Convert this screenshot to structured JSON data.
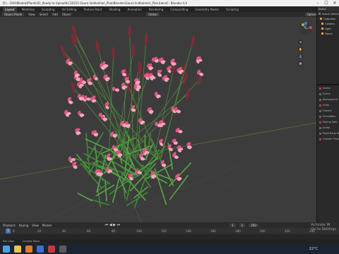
{
  "window": {
    "title": "D:\\...CHU\\Models\\Plants\\01_Ready to Upload\\LC20315 Gaura lindheimeri_Pink\\Blender\\Gaura lindheimeri_Pink.blend] - Blender 4.4",
    "min": "–",
    "max": "☐",
    "close": "✕"
  },
  "menu": {
    "tabs": [
      "Layout",
      "Modeling",
      "Sculpting",
      "UV Editing",
      "Texture Paint",
      "Shading",
      "Animation",
      "Rendering",
      "Compositing",
      "Geometry Nodes",
      "Scripting"
    ],
    "active": "Layout",
    "scene_label": "Scene"
  },
  "viewport_header": {
    "mode": "Object Mode",
    "menus": [
      "View",
      "Select",
      "Add",
      "Object"
    ],
    "orientation": "Global",
    "options": "Options"
  },
  "nav_gizmo": {
    "axes": [
      "X",
      "Y",
      "Z"
    ]
  },
  "outliner": {
    "rows": [
      "Scene Collection",
      "Collection",
      "Camera",
      "Light",
      "Gaura"
    ]
  },
  "properties": {
    "tabs_icons": [
      "tool-icon",
      "render-icon",
      "output-icon",
      "view-layer-icon",
      "scene-icon",
      "world-icon"
    ],
    "rows": [
      "Scene",
      "Scene",
      "Background",
      "Units",
      "Gravity",
      "Simulation",
      "Keying Sets",
      "Audio",
      "Rigid Body World",
      "Custom Properties"
    ]
  },
  "timeline": {
    "menus": [
      "Playback",
      "Keying",
      "View",
      "Marker"
    ],
    "current_frame": "1",
    "start": "1",
    "end": "250",
    "ticks": [
      "0",
      "20",
      "40",
      "60",
      "80",
      "100",
      "120",
      "140",
      "160",
      "180",
      "200",
      "220",
      "240"
    ]
  },
  "status": {
    "left": "Pan View",
    "middle": "Context Menu"
  },
  "watermark": {
    "line1": "Activate W",
    "line2": "Go to Settings"
  },
  "taskbar": {
    "temp": "22°C",
    "time": ""
  },
  "colors": {
    "accent": "#4772b3",
    "flower": "#e0557f",
    "leaf": "#5aa545",
    "bud": "#7a2d35"
  }
}
